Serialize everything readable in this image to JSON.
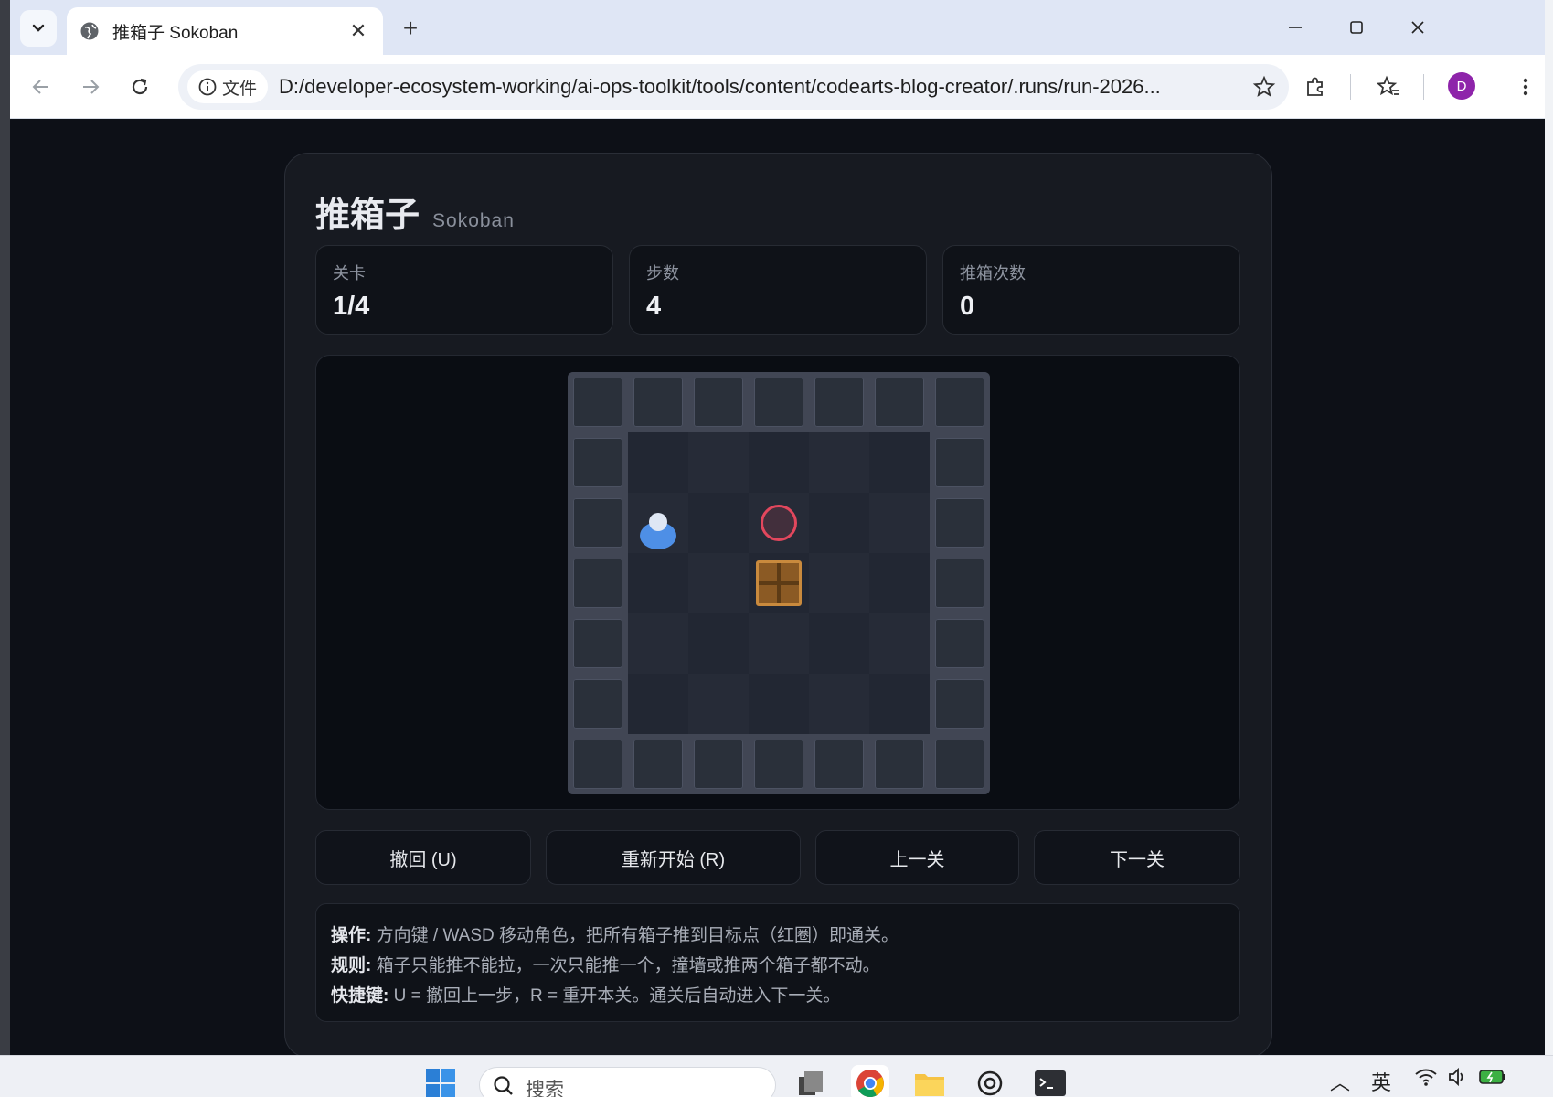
{
  "browser": {
    "tab_title": "推箱子 Sokoban",
    "file_chip_label": "文件",
    "url": "D:/developer-ecosystem-working/ai-ops-toolkit/tools/content/codearts-blog-creator/.runs/run-2026...",
    "avatar_letter": "D"
  },
  "game": {
    "title": "推箱子",
    "subtitle": "Sokoban",
    "stats": [
      {
        "label": "关卡",
        "value": "1/4"
      },
      {
        "label": "步数",
        "value": "4"
      },
      {
        "label": "推箱次数",
        "value": "0"
      }
    ],
    "board": {
      "rows": [
        "#######",
        "#.....#",
        "#@.T..#",
        "#..B..#",
        "#.....#",
        "#.....#",
        "#######"
      ],
      "legend": {
        "#": "wall",
        ".": "floor",
        "@": "player",
        "T": "target",
        "B": "box"
      }
    },
    "buttons": {
      "undo": "撤回 (U)",
      "restart": "重新开始 (R)",
      "prev": "上一关",
      "next": "下一关"
    },
    "help": [
      {
        "key": "操作:",
        "text": "方向键 / WASD 移动角色，把所有箱子推到目标点（红圈）即通关。"
      },
      {
        "key": "规则:",
        "text": "箱子只能推不能拉，一次只能推一个，撞墙或推两个箱子都不动。"
      },
      {
        "key": "快捷键:",
        "text": "U = 撤回上一步，R = 重开本关。通关后自动进入下一关。"
      }
    ]
  },
  "taskbar": {
    "search_placeholder": "搜索",
    "ime_label": "英"
  },
  "colors": {
    "accent_target": "#e2475d",
    "player": "#4e8fe6",
    "box": "#8b5a24"
  }
}
